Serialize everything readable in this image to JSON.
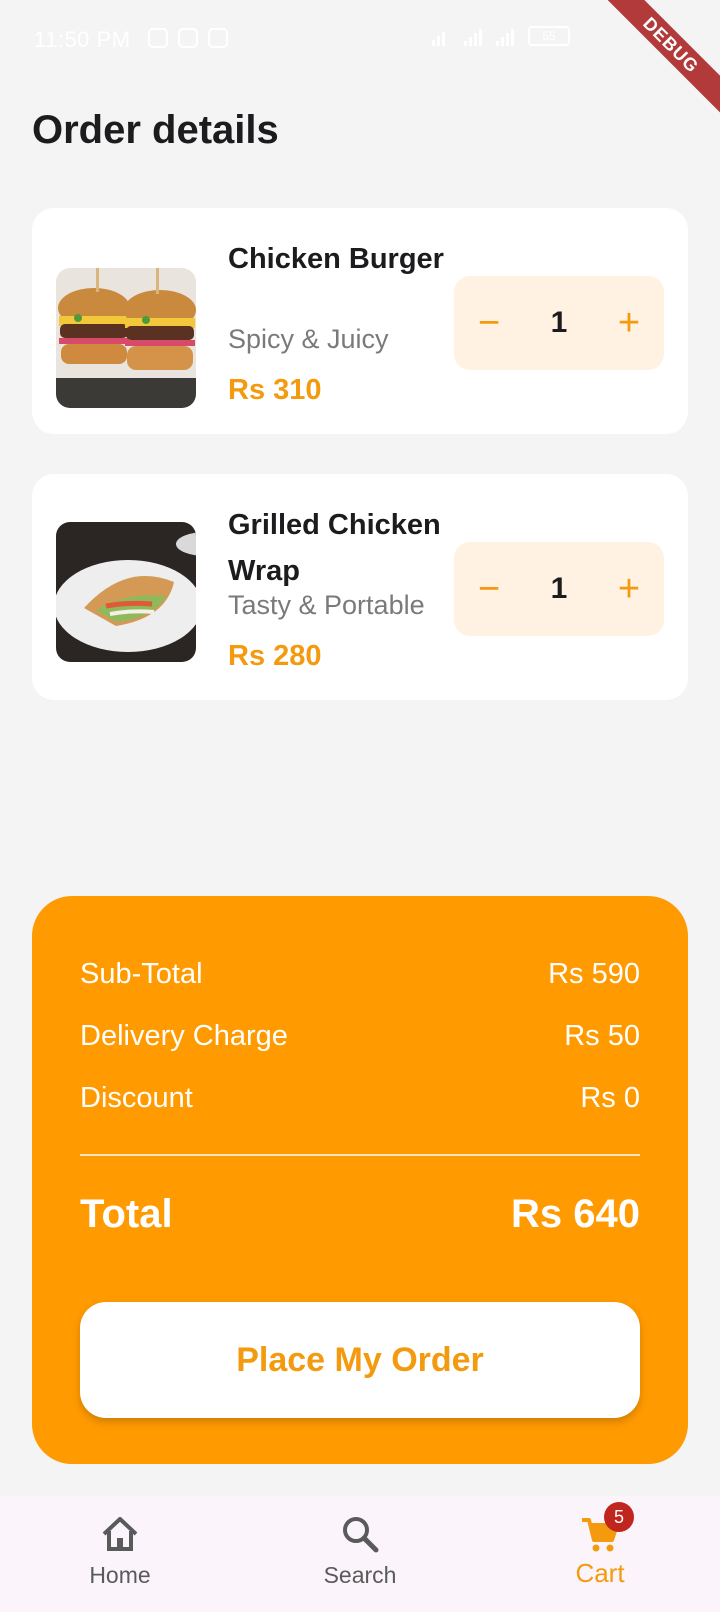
{
  "status_bar": {
    "time": "11:50 PM",
    "battery": "55"
  },
  "debug_banner": "DEBUG",
  "page": {
    "title": "Order details"
  },
  "orders": [
    {
      "name": "Chicken Burger",
      "description": "Spicy & Juicy",
      "price": "Rs 310",
      "quantity": "1",
      "image": "burger-photo"
    },
    {
      "name": "Grilled Chicken Wrap",
      "description": "Tasty & Portable",
      "price": "Rs 280",
      "quantity": "1",
      "image": "wrap-photo"
    }
  ],
  "quantity_controls": {
    "minus": "−",
    "plus": "+"
  },
  "summary": {
    "subtotal_label": "Sub-Total",
    "subtotal_value": "Rs 590",
    "delivery_label": "Delivery Charge",
    "delivery_value": "Rs 50",
    "discount_label": "Discount",
    "discount_value": "Rs 0",
    "total_label": "Total",
    "total_value": "Rs 640",
    "button_label": "Place My Order"
  },
  "bottom_nav": {
    "items": [
      {
        "label": "Home",
        "icon": "home-icon"
      },
      {
        "label": "Search",
        "icon": "search-icon"
      },
      {
        "label": "Cart",
        "icon": "cart-icon",
        "active": true
      }
    ],
    "cart_badge": "5"
  },
  "colors": {
    "accent": "#FF9A00",
    "price_text": "#F39A0F",
    "qty_bg": "#FFF2E3",
    "badge": "#C0261D",
    "background": "#F4F4F4"
  }
}
